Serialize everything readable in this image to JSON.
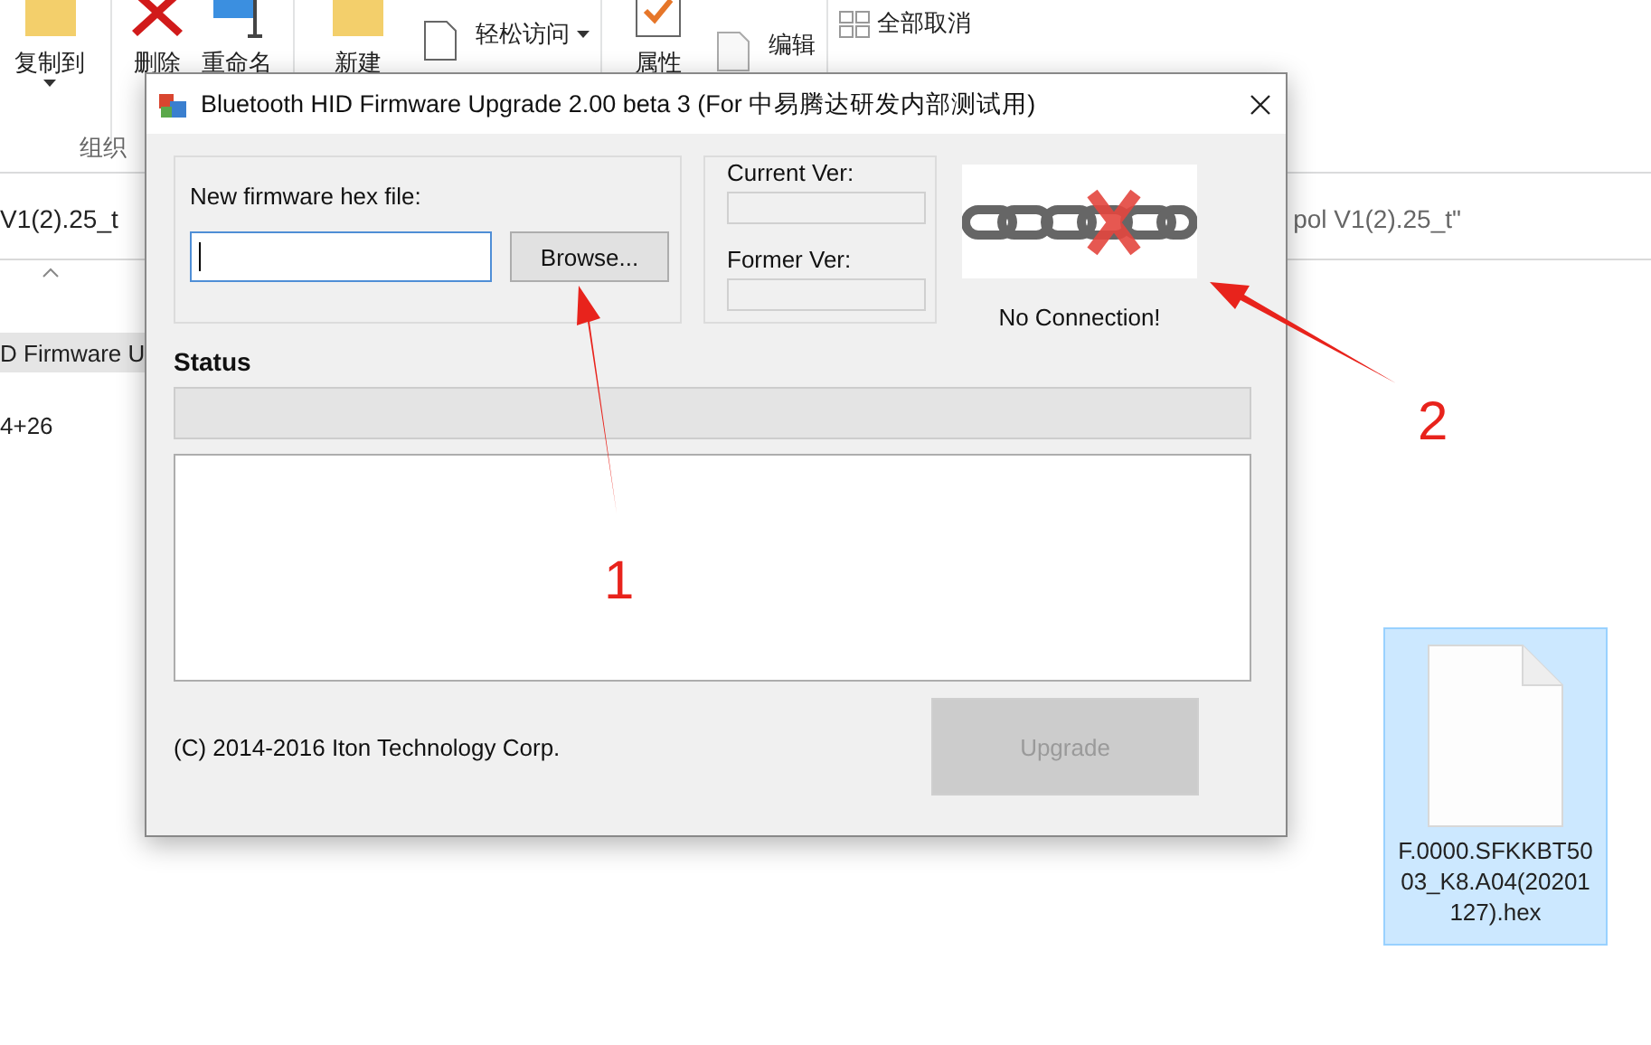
{
  "explorer": {
    "ribbon": {
      "items": [
        {
          "label": "复制到",
          "kind": "folder",
          "dropdown": true
        },
        {
          "label": "删除",
          "kind": "delete"
        },
        {
          "label": "重命名",
          "kind": "rename"
        },
        {
          "label": "新建",
          "kind": "folder"
        },
        {
          "label": "轻松访问",
          "kind": "easy",
          "dropdown": true
        },
        {
          "label": "属性",
          "kind": "check"
        },
        {
          "label": "编辑",
          "kind": "edit"
        },
        {
          "label": "全部取消",
          "kind": "grid"
        }
      ],
      "group_label": "组织"
    },
    "address": "V1(2).25_t",
    "search": "pol V1(2).25_t\"",
    "rows": [
      {
        "text": "D Firmware U",
        "selected": true
      },
      {
        "text": "4+26",
        "selected": false
      }
    ],
    "file": {
      "name": "F.0000.SFKKBT5003_K8.A04(20201127).hex",
      "selected": true
    }
  },
  "dialog": {
    "title": "Bluetooth HID Firmware Upgrade 2.00 beta 3 (For 中易腾达研发内部测试用)",
    "file_label": "New firmware hex file:",
    "browse": "Browse...",
    "current_ver": "Current Ver:",
    "former_ver": "Former Ver:",
    "connection": "No Connection!",
    "status_label": "Status",
    "copyright": "(C) 2014-2016 Iton Technology Corp.",
    "upgrade": {
      "label": "Upgrade",
      "disabled": true
    }
  },
  "annotations": [
    {
      "label": "1"
    },
    {
      "label": "2"
    }
  ]
}
